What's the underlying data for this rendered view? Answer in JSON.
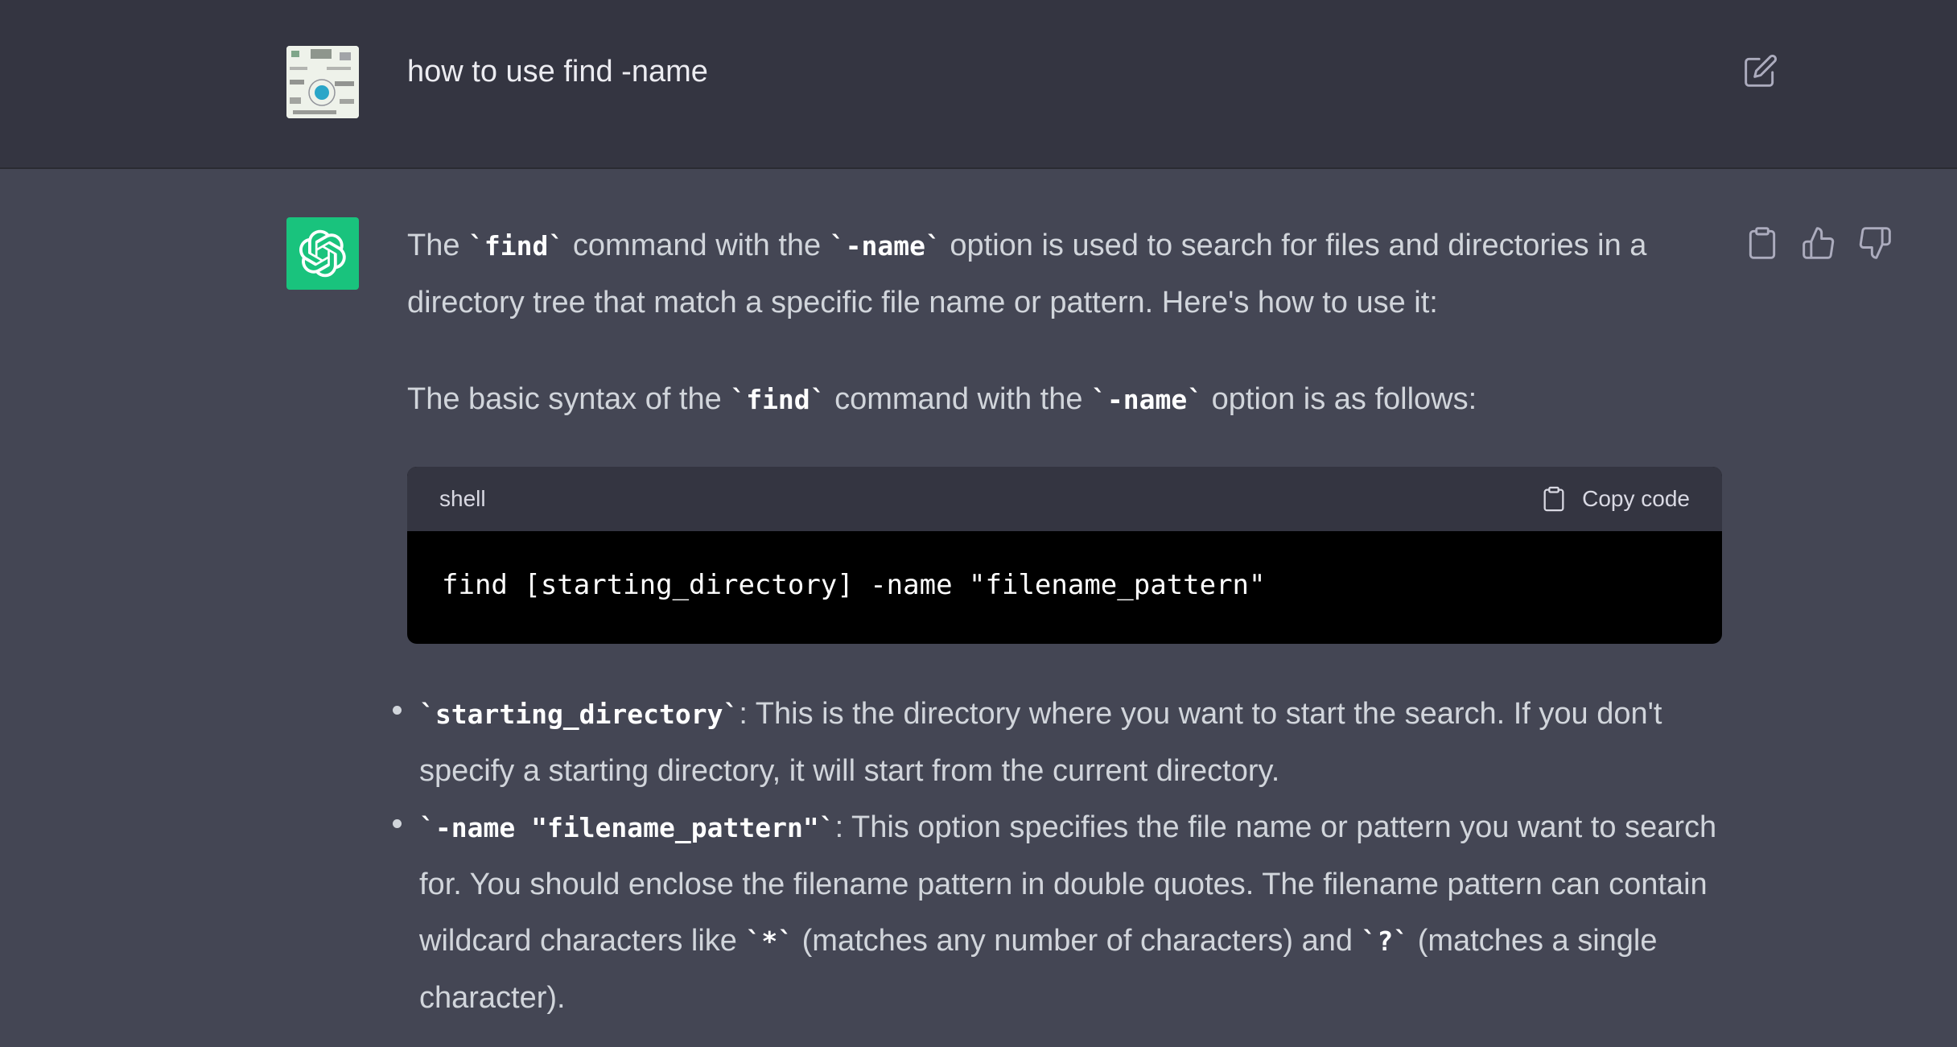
{
  "user": {
    "message": "how to use find -name"
  },
  "assistant": {
    "para1": {
      "t1": "The ",
      "c1": "`find`",
      "t2": " command with the ",
      "c2": "`-name`",
      "t3": " option is used to search for files and directories in a directory tree that match a specific file name or pattern. Here's how to use it:"
    },
    "para2": {
      "t1": "The basic syntax of the ",
      "c1": "`find`",
      "t2": " command with the ",
      "c2": "`-name`",
      "t3": " option is as follows:"
    },
    "code_block": {
      "language": "shell",
      "copy_label": "Copy code",
      "code": "find [starting_directory] -name \"filename_pattern\""
    },
    "bullets": [
      {
        "code": "`starting_directory`",
        "text": ": This is the directory where you want to start the search. If you don't specify a starting directory, it will start from the current directory."
      },
      {
        "code": "`-name \"filename_pattern\"`",
        "text_a": ": This option specifies the file name or pattern you want to search for. You should enclose the filename pattern in double quotes. The filename pattern can contain wildcard characters like ",
        "code_b": "`*`",
        "text_b": " (matches any number of characters) and ",
        "code_c": "`?`",
        "text_c": " (matches a single character)."
      }
    ]
  },
  "icons": {
    "edit": "edit-icon",
    "copy": "clipboard-icon",
    "like": "thumbs-up-icon",
    "dislike": "thumbs-down-icon",
    "logo": "openai-logo-icon"
  },
  "colors": {
    "user_bg": "#343541",
    "assistant_bg": "#444654",
    "brand_green": "#19c37d",
    "code_bg": "#000000"
  }
}
